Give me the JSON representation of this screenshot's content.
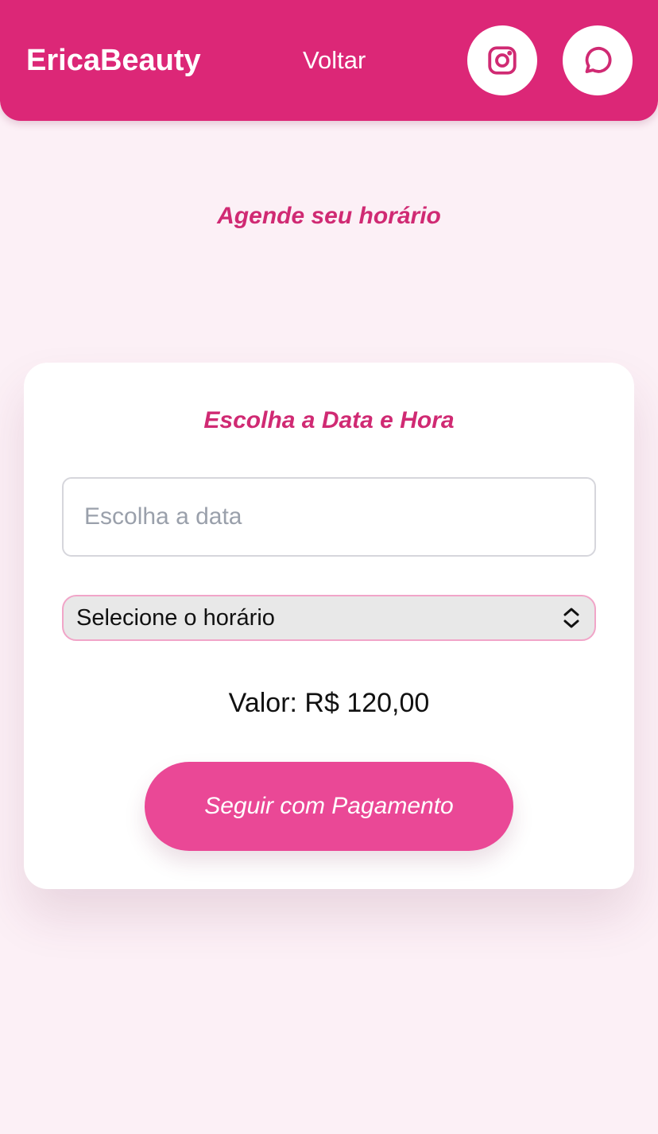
{
  "header": {
    "brand": "EricaBeauty",
    "back_label": "Voltar",
    "icons": [
      "instagram-icon",
      "chat-icon"
    ],
    "color": "#dc2777"
  },
  "main": {
    "heading": "Agende seu horário"
  },
  "form": {
    "title": "Escolha a Data e Hora",
    "date_placeholder": "Escolha a data",
    "date_value": "",
    "time_selected": "Selecione o horário",
    "price_text": "Valor: R$ 120,00",
    "submit_label": "Seguir com Pagamento"
  },
  "colors": {
    "accent": "#dc2777",
    "button": "#ea4896",
    "heading_text": "#d02a73",
    "background": "#fcf0f6"
  }
}
